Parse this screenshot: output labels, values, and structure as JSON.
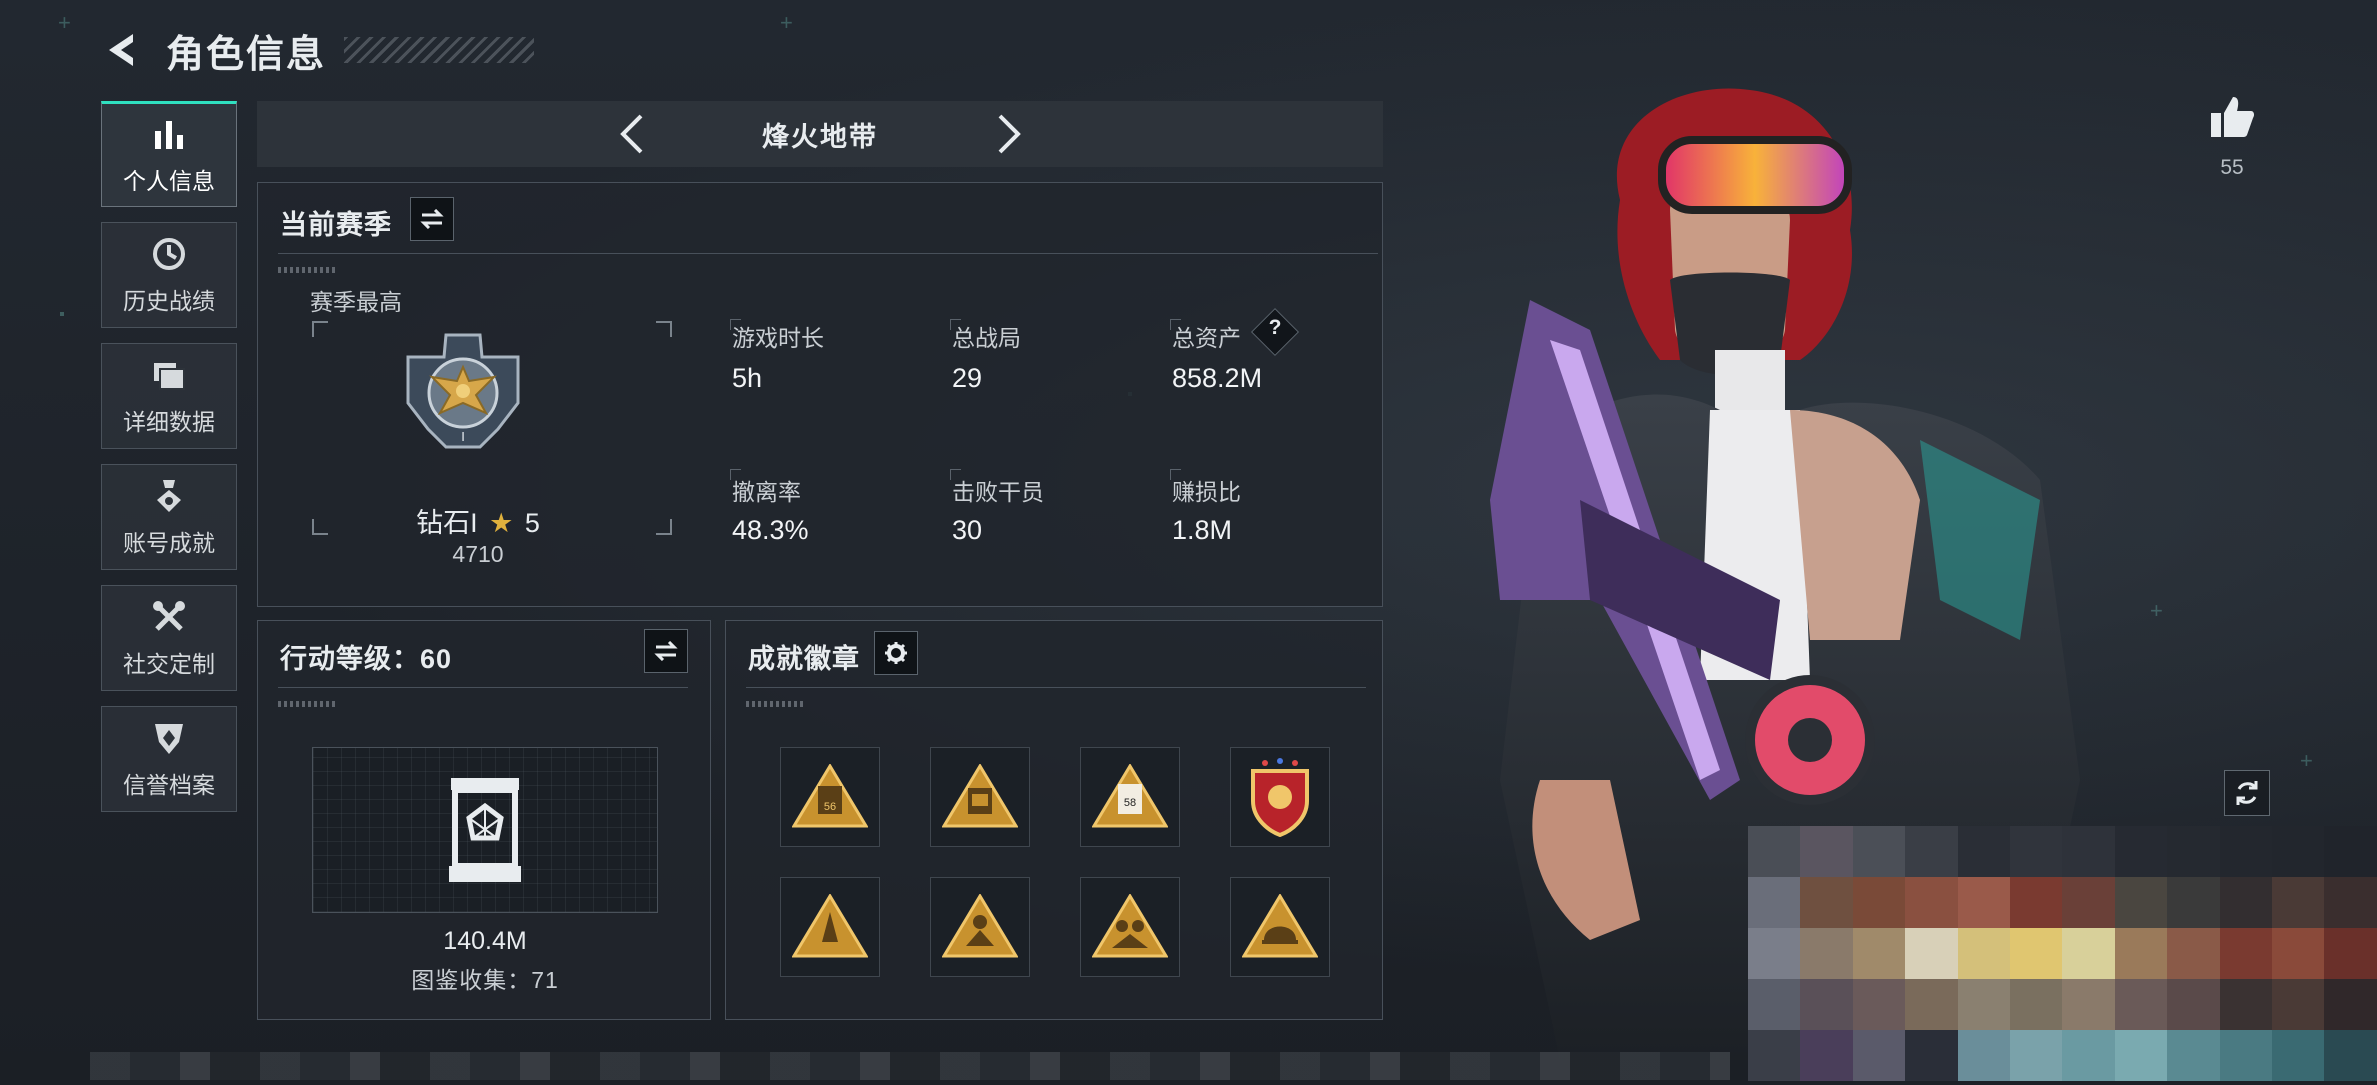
{
  "header": {
    "title": "角色信息"
  },
  "nav": {
    "items": [
      {
        "label": "个人信息",
        "icon": "bar-chart-icon",
        "active": true
      },
      {
        "label": "历史战绩",
        "icon": "history-clock-icon",
        "active": false
      },
      {
        "label": "详细数据",
        "icon": "folders-icon",
        "active": false
      },
      {
        "label": "账号成就",
        "icon": "achievement-icon",
        "active": false
      },
      {
        "label": "社交定制",
        "icon": "tools-icon",
        "active": false
      },
      {
        "label": "信誉档案",
        "icon": "shield-icon",
        "active": false
      }
    ]
  },
  "mode": {
    "title": "烽火地带"
  },
  "season": {
    "title": "当前赛季",
    "best_label": "赛季最高",
    "rank_name": "钻石I",
    "rank_stars": "5",
    "rank_points": "4710",
    "stats": [
      {
        "label": "游戏时长",
        "value": "5h"
      },
      {
        "label": "总战局",
        "value": "29"
      },
      {
        "label": "总资产",
        "value": "858.2M"
      },
      {
        "label": "撤离率",
        "value": "48.3%"
      },
      {
        "label": "击败干员",
        "value": "30"
      },
      {
        "label": "赚损比",
        "value": "1.8M"
      }
    ]
  },
  "action_level": {
    "title": "行动等级：60",
    "value": "140.4M",
    "collection": "图鉴收集：71"
  },
  "badges": {
    "title": "成就徽章",
    "items": [
      {
        "text": "56"
      },
      {
        "text": ""
      },
      {
        "text": "58"
      },
      {
        "text": ""
      },
      {
        "text": ""
      },
      {
        "text": ""
      },
      {
        "text": ""
      },
      {
        "text": ""
      }
    ]
  },
  "likes": {
    "count": "55"
  },
  "colors": {
    "accent": "#2fe0c0",
    "gold": "#d8a441",
    "bg": "#1c2127"
  }
}
